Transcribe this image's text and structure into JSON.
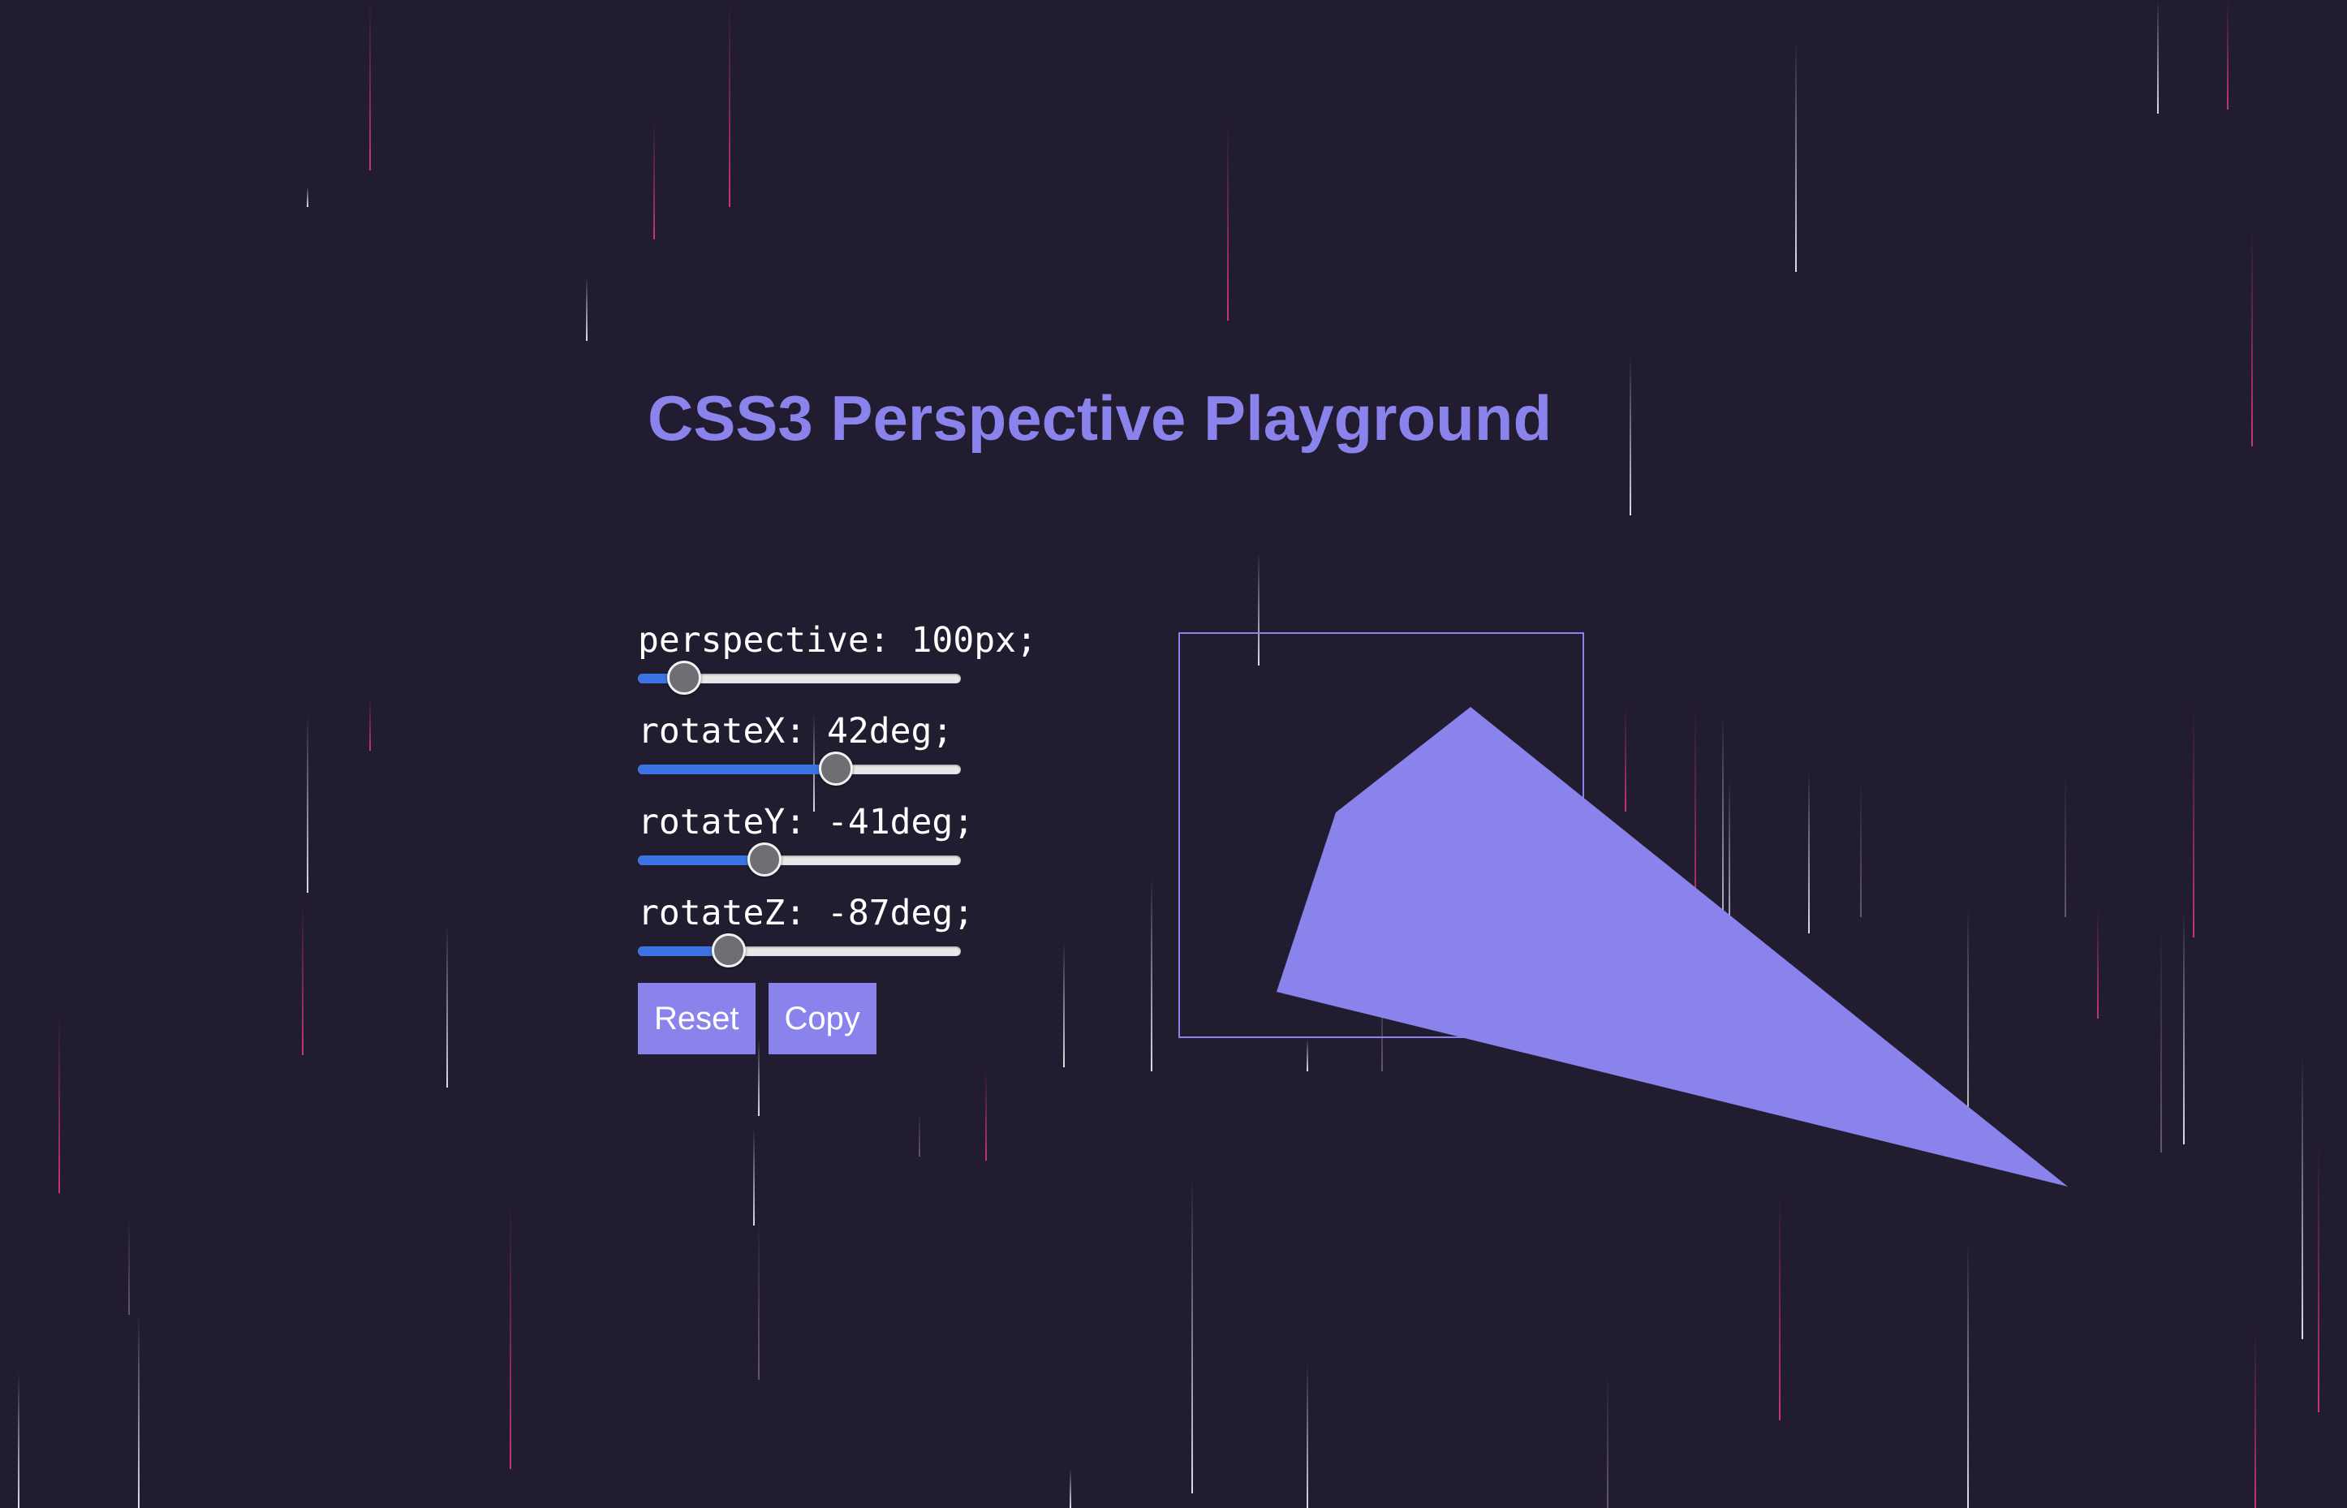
{
  "title": "CSS3 Perspective Playground",
  "controls": [
    {
      "label": "perspective: 100px;",
      "property": "perspective",
      "value": 100,
      "unit": "px",
      "fraction": 0.14
    },
    {
      "label": "rotateX: 42deg;",
      "property": "rotateX",
      "value": 42,
      "unit": "deg",
      "fraction": 0.61
    },
    {
      "label": "rotateY: -41deg;",
      "property": "rotateY",
      "value": -41,
      "unit": "deg",
      "fraction": 0.39
    },
    {
      "label": "rotateZ: -87deg;",
      "property": "rotateZ",
      "value": -87,
      "unit": "deg",
      "fraction": 0.28
    }
  ],
  "buttons": {
    "reset_label": "Reset",
    "copy_label": "Copy"
  },
  "colors": {
    "background": "#221c31",
    "accent": "#8a83ec",
    "slider_fill": "#3b74e2",
    "rain_white": "#ffffff",
    "rain_pink": "#e63c78"
  }
}
